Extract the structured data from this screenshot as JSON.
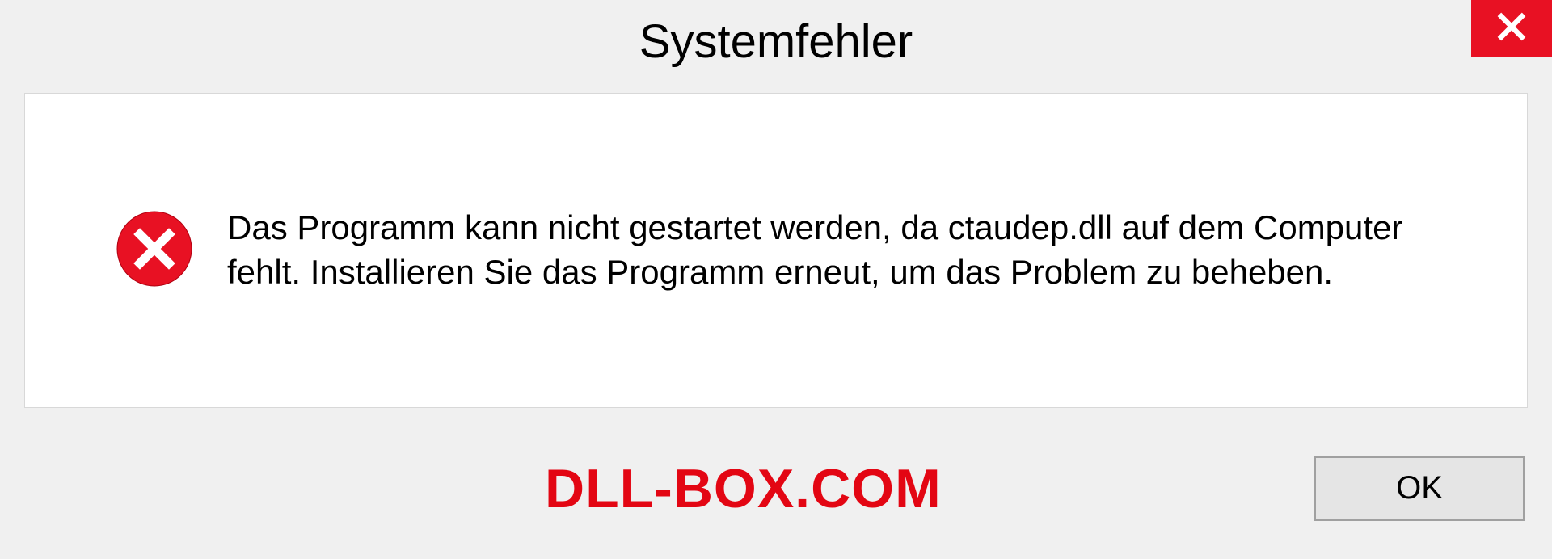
{
  "dialog": {
    "title": "Systemfehler",
    "message": "Das Programm kann nicht gestartet werden, da ctaudep.dll auf dem Computer fehlt. Installieren Sie das Programm erneut, um das Problem zu beheben.",
    "ok_label": "OK"
  },
  "watermark": "DLL-BOX.COM"
}
